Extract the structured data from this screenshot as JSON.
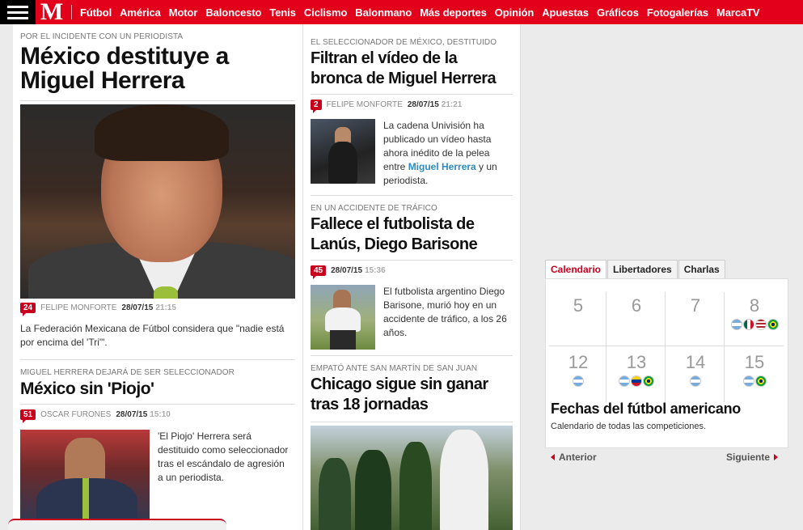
{
  "nav": {
    "items": [
      "Fútbol",
      "América",
      "Motor",
      "Baloncesto",
      "Tenis",
      "Ciclismo",
      "Balonmano",
      "Más deportes",
      "Opinión",
      "Apuestas",
      "Gráficos",
      "Fotogalerías",
      "MarcaTV"
    ],
    "logo": "M",
    "brand_color": "#e2001a"
  },
  "col1": {
    "main": {
      "kicker": "POR EL INCIDENTE CON UN PERIODISTA",
      "title_line1": "México destituye a",
      "title_line2": "Miguel Herrera",
      "comments": "24",
      "author": "FELIPE MONFORTE",
      "date": "28/07/15",
      "time": "21:15",
      "summary": "La Federación Mexicana de Fútbol considera que \"nadie está por encima del 'Tri'\"."
    },
    "second": {
      "kicker": "MIGUEL HERRERA DEJARÁ DE SER SELECCIONADOR",
      "title": "México sin 'Piojo'",
      "comments": "51",
      "author": "OSCAR FURONES",
      "date": "28/07/15",
      "time": "15:10",
      "summary": "'El Piojo' Herrera será destituido como seleccionador tras el escándalo de agresión a un periodista."
    }
  },
  "col2": {
    "a1": {
      "kicker": "EL SELECCIONADOR DE MÉXICO, DESTITUIDO",
      "title_line1": "Filtran el vídeo de la",
      "title_line2": "bronca de Miguel Herrera",
      "comments": "2",
      "author": "FELIPE MONFORTE",
      "date": "28/07/15",
      "time": "21:21",
      "summary_pre": "La cadena Univisión ha publicado un vídeo hasta ahora inédito de la pelea entre ",
      "summary_link": "Miguel Herrera",
      "summary_post": " y un periodista."
    },
    "a2": {
      "kicker": "EN UN ACCIDENTE DE TRÁFICO",
      "title_line1": "Fallece el futbolista de",
      "title_line2": "Lanús, Diego Barisone",
      "comments": "45",
      "date": "28/07/15",
      "time": "15:36",
      "summary": "El futbolista argentino Diego Barisone, murió hoy en un accidente de tráfico, a los 26 años."
    },
    "a3": {
      "kicker": "EMPATÓ ANTE SAN MARTÍN DE SAN JUAN",
      "title_line1": "Chicago sigue sin ganar",
      "title_line2": "tras 18 jornadas"
    }
  },
  "calendar": {
    "tabs": [
      "Calendario",
      "Libertadores",
      "Charlas"
    ],
    "days_row1": [
      "5",
      "6",
      "7",
      "8"
    ],
    "days_row2": [
      "12",
      "13",
      "14",
      "15"
    ],
    "title": "Fechas del fútbol americano",
    "subtitle": "Calendario de todas las competiciones.",
    "prev": "Anterior",
    "next": "Siguiente"
  }
}
